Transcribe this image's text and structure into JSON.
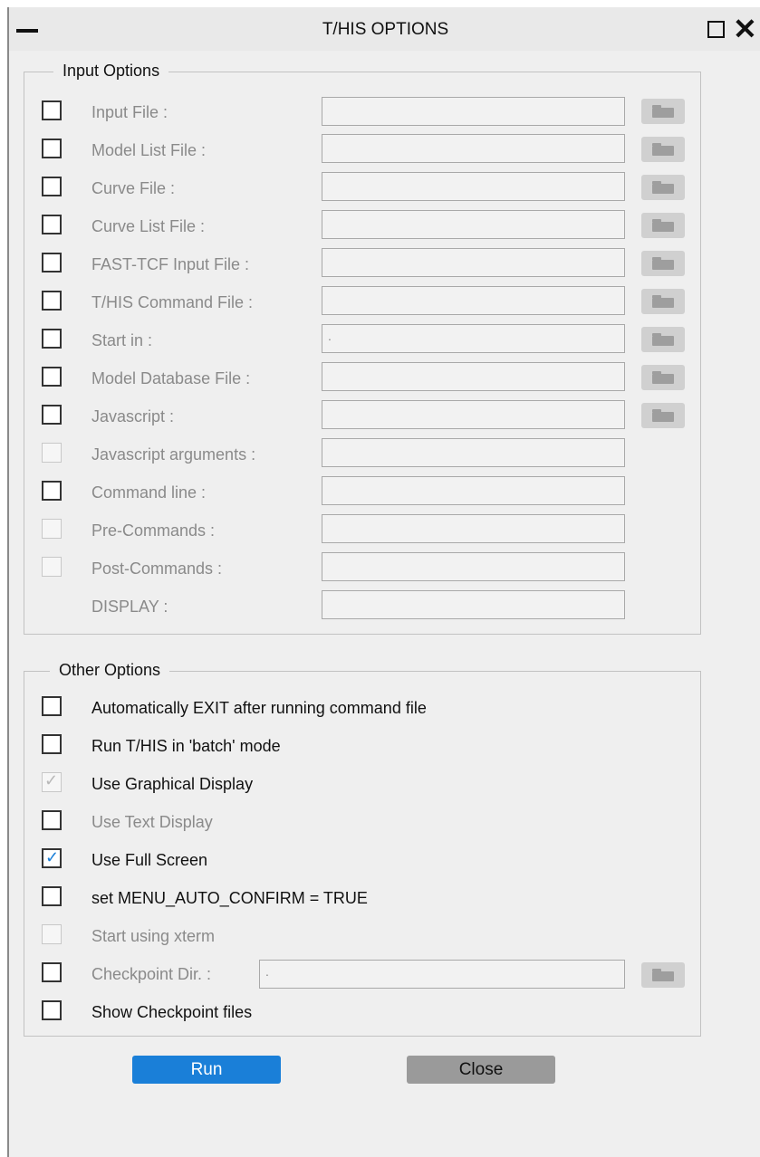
{
  "window": {
    "title": "T/HIS OPTIONS"
  },
  "input_options": {
    "legend": "Input Options",
    "rows": [
      {
        "label": "Input File :",
        "value": ""
      },
      {
        "label": "Model List File :",
        "value": ""
      },
      {
        "label": "Curve File :",
        "value": ""
      },
      {
        "label": "Curve List File :",
        "value": ""
      },
      {
        "label": "FAST-TCF Input File :",
        "value": ""
      },
      {
        "label": "T/HIS Command File :",
        "value": ""
      },
      {
        "label": "Start in :",
        "value": "."
      },
      {
        "label": "Model Database File :",
        "value": ""
      },
      {
        "label": "Javascript :",
        "value": ""
      },
      {
        "label": "Javascript arguments :",
        "value": ""
      },
      {
        "label": "Command line :",
        "value": ""
      },
      {
        "label": "Pre-Commands :",
        "value": ""
      },
      {
        "label": "Post-Commands :",
        "value": ""
      },
      {
        "label": "DISPLAY :",
        "value": ""
      }
    ]
  },
  "other_options": {
    "legend": "Other Options",
    "items": [
      {
        "label": "Automatically EXIT after running command file",
        "checked": false
      },
      {
        "label": "Run T/HIS in 'batch' mode",
        "checked": false
      },
      {
        "label": "Use Graphical Display",
        "checked": true
      },
      {
        "label": "Use Text Display",
        "checked": false
      },
      {
        "label": "Use Full Screen",
        "checked": true
      },
      {
        "label": "set MENU_AUTO_CONFIRM = TRUE",
        "checked": false
      },
      {
        "label": "Start using xterm",
        "checked": false
      },
      {
        "label": "Checkpoint Dir. :",
        "checked": false,
        "value": "."
      },
      {
        "label": "Show Checkpoint files",
        "checked": false
      }
    ]
  },
  "buttons": {
    "run": "Run",
    "close": "Close"
  },
  "colors": {
    "accent": "#1a7fd8",
    "panel": "#efefef"
  }
}
